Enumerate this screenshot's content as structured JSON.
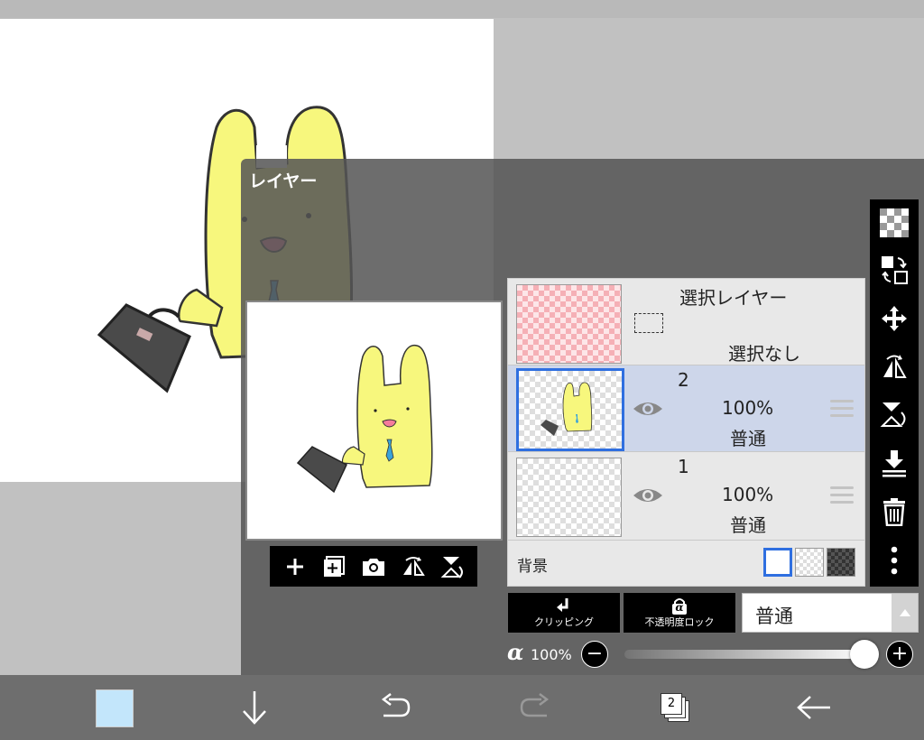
{
  "panel": {
    "title": "レイヤー"
  },
  "layers": {
    "selection": {
      "title": "選択レイヤー",
      "status": "選択なし"
    },
    "items": [
      {
        "name": "2",
        "opacity": "100%",
        "blend": "普通",
        "selected": true
      },
      {
        "name": "1",
        "opacity": "100%",
        "blend": "普通",
        "selected": false
      }
    ],
    "background_label": "背景"
  },
  "buttons": {
    "clipping": "クリッピング",
    "alpha_lock": "不透明度ロック",
    "alpha_lock_symbol": "α",
    "blend_mode": "普通"
  },
  "alpha": {
    "symbol": "α",
    "value": "100%",
    "minus": "−",
    "plus": "+",
    "fraction": 1.0
  },
  "bottom": {
    "color": "#c3e6fb",
    "layer_count": "2"
  },
  "colors": {
    "accent": "#2f6fe0",
    "character": "#f7f77d",
    "tie": "#3aa3d9",
    "bag": "#4a4a4a"
  },
  "icons": {
    "preview_toolbar": [
      "add-icon",
      "add-layer-icon",
      "camera-icon",
      "flip-horizontal-icon",
      "flip-vertical-icon"
    ],
    "side_toolbar": [
      "transparency-icon",
      "swap-layer-icon",
      "move-icon",
      "rotate-flip-icon",
      "flip-rotate-icon",
      "merge-down-icon",
      "trash-icon",
      "more-icon"
    ],
    "bottom_bar": [
      "color-swatch",
      "down-arrow-icon",
      "undo-icon",
      "redo-icon",
      "layers-icon",
      "back-icon"
    ]
  }
}
